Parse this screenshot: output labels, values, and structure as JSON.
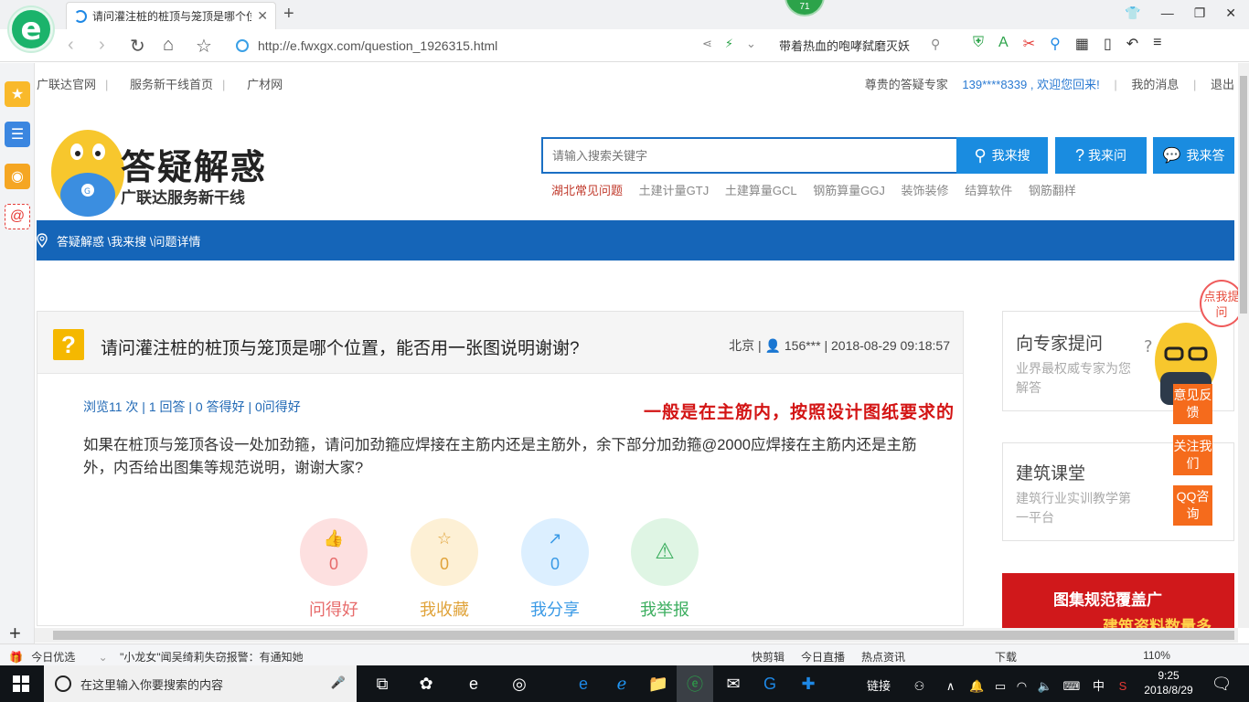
{
  "browser": {
    "tab_title": "请问灌注桩的桩顶与笼顶是哪个位置",
    "new_tab": "+",
    "badge": "71",
    "url": "http://e.fwxgx.com/question_1926315.html",
    "search_suggest": "带着热血的咆哮弑磨灭妖"
  },
  "topnav": {
    "left": [
      "广联达官网",
      "服务新干线首页",
      "广材网"
    ],
    "expert": "尊贵的答疑专家",
    "user_greeting": "139****8339 , 欢迎您回来!",
    "messages": "我的消息",
    "logout": "退出"
  },
  "header": {
    "logo_title": "答疑解惑",
    "logo_sub": "广联达服务新干线",
    "search_placeholder": "请输入搜索关键字",
    "btn_search": "我来搜",
    "btn_ask": "我来问",
    "btn_answer": "我来答",
    "hot_links": [
      "湖北常见问题",
      "土建计量GTJ",
      "土建算量GCL",
      "钢筋算量GGJ",
      "装饰装修",
      "结算软件",
      "钢筋翻样"
    ]
  },
  "breadcrumb": "答疑解惑 \\我来搜 \\问题详情",
  "question": {
    "title": "请问灌注桩的桩顶与笼顶是哪个位置，能否用一张图说明谢谢?",
    "location": "北京",
    "user": "156***",
    "datetime": "2018-08-29 09:18:57",
    "stats": "浏览11 次 | 1 回答 | 0 答得好 | 0问得好",
    "body": "如果在桩顶与笼顶各设一处加劲箍，请问加劲箍应焊接在主筋内还是主筋外，余下部分加劲箍@2000应焊接在主筋内还是主筋外，内否给出图集等规范说明，谢谢大家?",
    "actions": [
      {
        "label": "问得好",
        "count": "0"
      },
      {
        "label": "我收藏",
        "count": "0"
      },
      {
        "label": "我分享",
        "count": "0"
      },
      {
        "label": "我举报",
        "count": ""
      }
    ]
  },
  "answer_hint": "一般是在主筋内，按照设计图纸要求的",
  "sidebar": {
    "expert_title": "向专家提问",
    "expert_desc": "业界最权威专家为您解答",
    "class_title": "建筑课堂",
    "class_desc": "建筑行业实训教学第一平台",
    "float_feedback": "意见反馈",
    "float_follow": "关注我们",
    "float_qq": "QQ咨询",
    "tiqi": "点我提问",
    "banner_line1": "图集规范覆盖广",
    "banner_line2": "建筑资料数量多"
  },
  "statusbar": {
    "today": "今日优选",
    "news": "\"小龙女\"闻吴绮莉失窃报警：有通知她",
    "items": [
      "快剪辑",
      "今日直播",
      "热点资讯",
      "下载",
      "110%"
    ]
  },
  "taskbar": {
    "search_placeholder": "在这里输入你要搜索的内容",
    "link": "链接",
    "ime": "中",
    "time": "9:25",
    "date": "2018/8/29"
  },
  "colors": {
    "brand_blue": "#1565b8",
    "search_blue": "#1a8ce0",
    "accent_orange": "#f56b1c",
    "answer_red": "#d31414"
  }
}
